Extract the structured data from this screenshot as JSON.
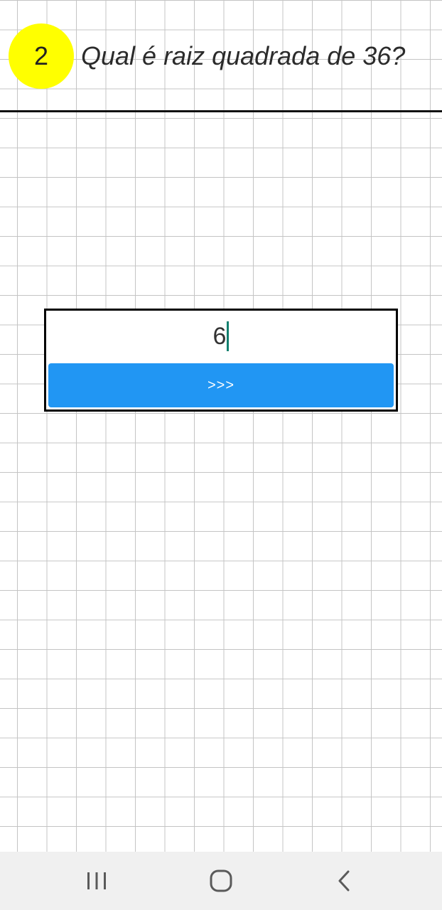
{
  "question": {
    "number": "2",
    "text": "Qual é raiz quadrada de 36?"
  },
  "answer": {
    "value": "6"
  },
  "submit": {
    "label": ">>>",
    "color": "#2196f3"
  },
  "badge_color": "#ffff00",
  "navbar": {
    "icons": [
      "recent-apps-icon",
      "home-icon",
      "back-icon"
    ]
  }
}
